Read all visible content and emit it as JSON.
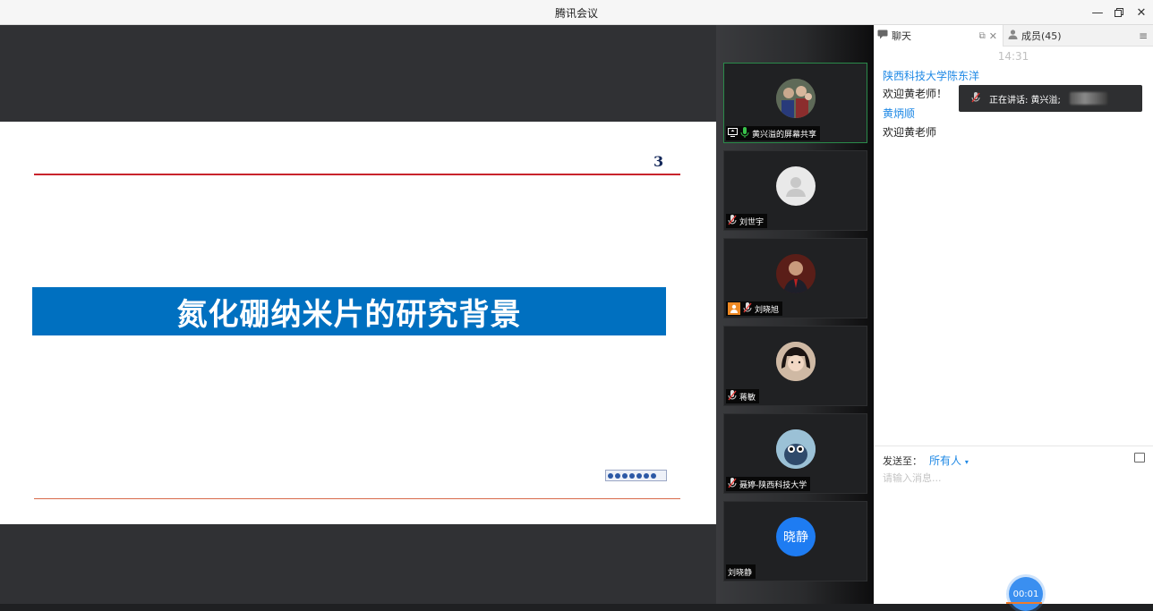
{
  "window": {
    "title": "腾讯会议",
    "controls": [
      "minimize-icon",
      "restore-icon",
      "close-icon"
    ]
  },
  "slide": {
    "page_number": "3",
    "heading": "氮化硼纳米片的研究背景",
    "colors": {
      "banner": "#0070c0",
      "rule": "#c8232c"
    }
  },
  "participants": [
    {
      "name": "黄兴溢的屏幕共享",
      "icons": [
        "screen-share-icon",
        "mic-on-icon"
      ],
      "active": true,
      "avatar": "photo"
    },
    {
      "name": "刘世宇",
      "icons": [
        "mic-muted-icon"
      ],
      "avatar": "default-user"
    },
    {
      "name": "刘晓旭",
      "icons": [
        "host-badge-icon",
        "mic-muted-icon"
      ],
      "avatar": "photo"
    },
    {
      "name": "蒋敏",
      "icons": [
        "mic-muted-icon"
      ],
      "avatar": "photo"
    },
    {
      "name": "聂婷-陕西科技大学",
      "icons": [
        "mic-muted-icon"
      ],
      "avatar": "photo"
    },
    {
      "name": "刘晓静",
      "icons": [],
      "avatar": "initials",
      "initials": "晓静"
    }
  ],
  "sidepanel": {
    "tabs": [
      {
        "label": "聊天",
        "icon": "chat-icon"
      },
      {
        "label": "成员(45)",
        "icon": "members-icon"
      }
    ],
    "chat": {
      "time": "14:31",
      "messages": [
        {
          "sender": "陕西科技大学陈东洋",
          "text": "欢迎黄老师！"
        },
        {
          "sender": "黄炳顺",
          "text": "欢迎黄老师"
        }
      ],
      "speaking_label": "正在讲话: 黄兴溢;",
      "send_to_label": "发送至：",
      "send_to_target": "所有人",
      "input_placeholder": "请输入消息..."
    },
    "timer": "00:01"
  }
}
